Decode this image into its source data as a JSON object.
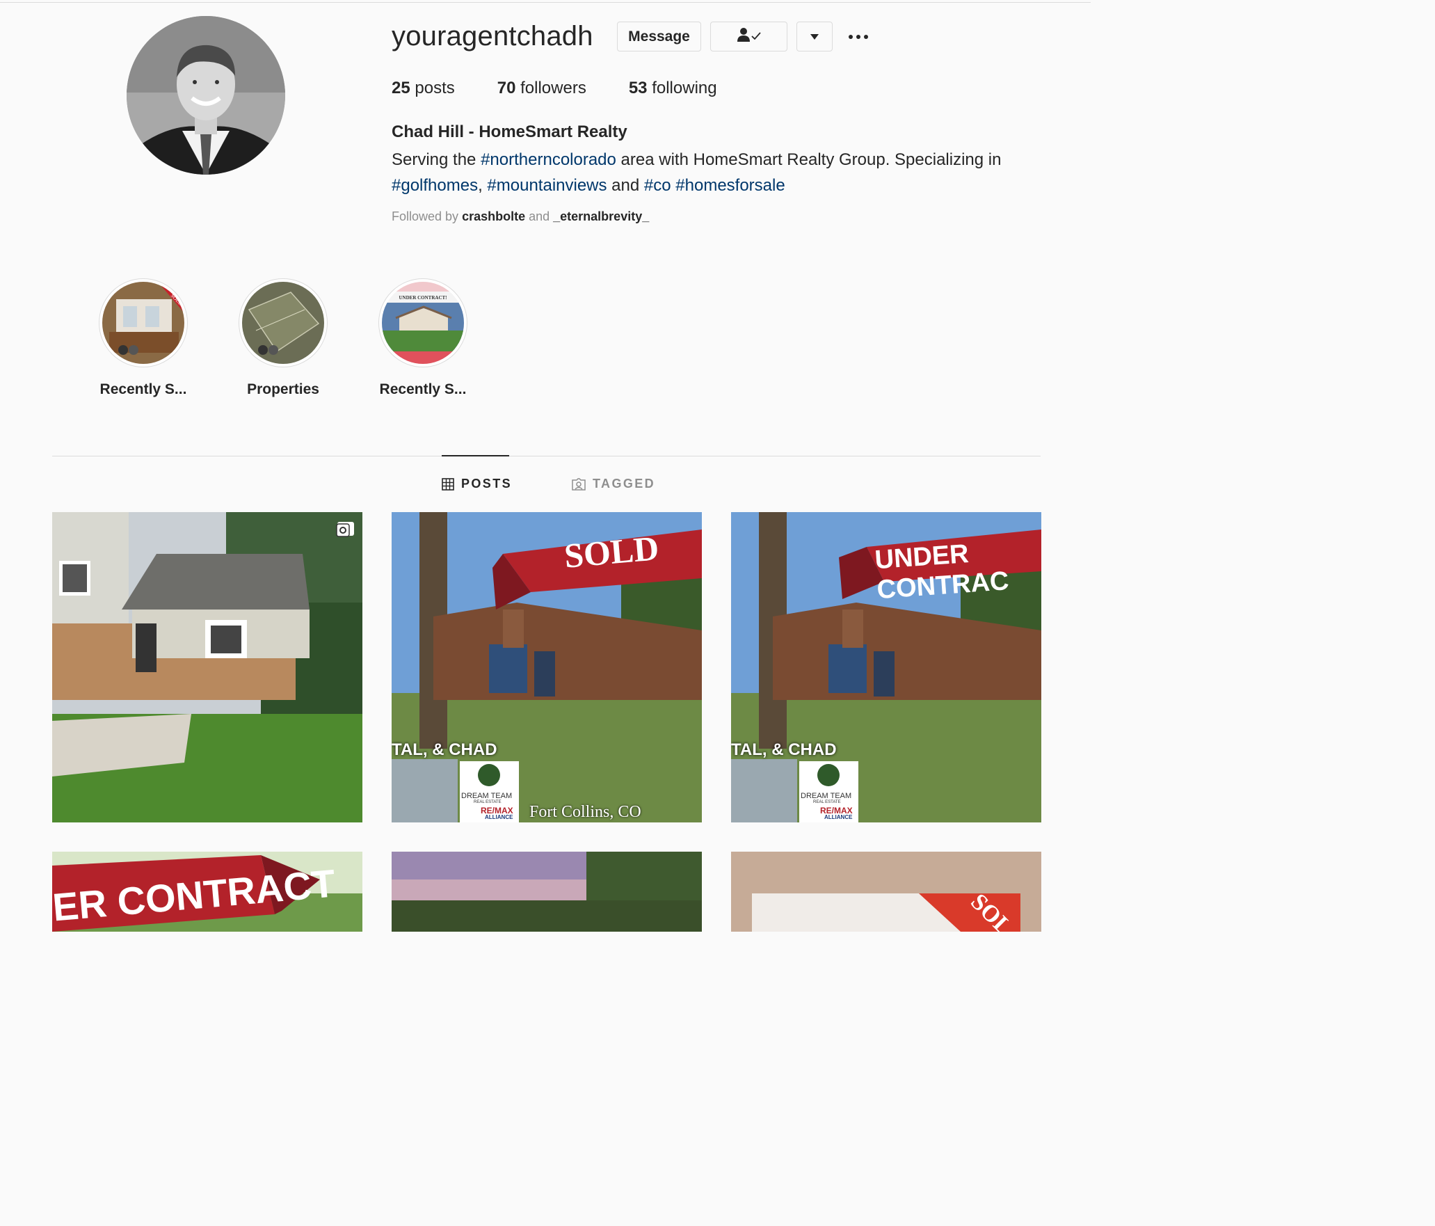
{
  "profile": {
    "username": "youragentchadh",
    "message_button": "Message",
    "stats": {
      "posts_count": "25",
      "posts_label": "posts",
      "followers_count": "70",
      "followers_label": "followers",
      "following_count": "53",
      "following_label": "following"
    },
    "full_name": "Chad Hill - HomeSmart Realty",
    "bio": {
      "part1": "Serving the ",
      "tag1": "#northerncolorado",
      "part2": " area with HomeSmart Realty Group. Specializing in ",
      "tag2": "#golfhomes",
      "part3": ", ",
      "tag3": "#mountainviews",
      "part4": " and ",
      "tag4": "#co",
      "part5": " ",
      "tag5": "#homesforsale"
    },
    "followed_by": {
      "prefix": "Followed by ",
      "user1": "crashbolte",
      "and": " and ",
      "user2": "_eternalbrevity_"
    }
  },
  "highlights": [
    {
      "label": "Recently S...",
      "badge": "SOLD"
    },
    {
      "label": "Properties"
    },
    {
      "label": "Recently S...",
      "badge": "UNDER CONTRACT!"
    }
  ],
  "tabs": {
    "posts": "POSTS",
    "tagged": "TAGGED"
  },
  "posts": [
    {
      "type": "carousel"
    },
    {
      "banner": "SOLD",
      "names": "TAL, & CHAD",
      "brand1": "DREAM TEAM",
      "brand1_sub": "REAL ESTATE",
      "brand2": "RE/MAX",
      "brand2_sub": "ALLIANCE",
      "location": "Fort Collins, CO"
    },
    {
      "banner": "UNDER CONTRAC",
      "names": "TAL, & CHAD",
      "brand1": "DREAM TEAM",
      "brand1_sub": "REAL ESTATE",
      "brand2": "RE/MAX",
      "brand2_sub": "ALLIANCE"
    },
    {
      "banner": "ER CONTRACT"
    },
    {},
    {
      "banner": "SOL"
    }
  ],
  "colors": {
    "link": "#00376b",
    "text": "#262626",
    "muted": "#8e8e8e",
    "border": "#dbdbdb",
    "banner_red": "#b3222a"
  }
}
